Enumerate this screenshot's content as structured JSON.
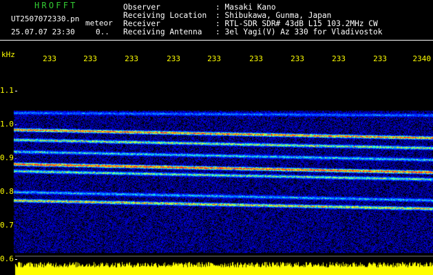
{
  "header": {
    "app_title": "HROFFT",
    "filename": "UT2507072330.pn",
    "tag": "meteor",
    "datetime": "25.07.07 23:30",
    "counter": "0.."
  },
  "info": [
    {
      "label": "Observer",
      "value": ": Masaki Kano"
    },
    {
      "label": "Receiving Location",
      "value": ": Shibukawa, Gunma, Japan"
    },
    {
      "label": "Receiver",
      "value": ": RTL-SDR SDR# 43dB L15 103.2MHz CW"
    },
    {
      "label": "Receiving Antenna",
      "value": ": 3el Yagi(V) Az 330 for Vladivostok"
    }
  ],
  "colors": {
    "app_title": "#33cc33",
    "header_text": "#ffffff",
    "axis_text": "#ffff00",
    "background": "#000000",
    "noise_bar": "#ffff00"
  },
  "chart_data": {
    "type": "heatmap",
    "ylabel": "kHz",
    "y_ticks": [
      "1.1",
      "1.0",
      "0.9",
      "0.8",
      "0.7",
      "0.6"
    ],
    "x_ticks": [
      "233",
      "233",
      "233",
      "233",
      "233",
      "233",
      "233",
      "233",
      "233",
      "2340"
    ],
    "ylim": [
      0.6,
      1.15
    ],
    "signal_bands_khz": [
      1.035,
      0.985,
      0.955,
      0.92,
      0.883,
      0.862,
      0.8,
      0.775
    ]
  }
}
